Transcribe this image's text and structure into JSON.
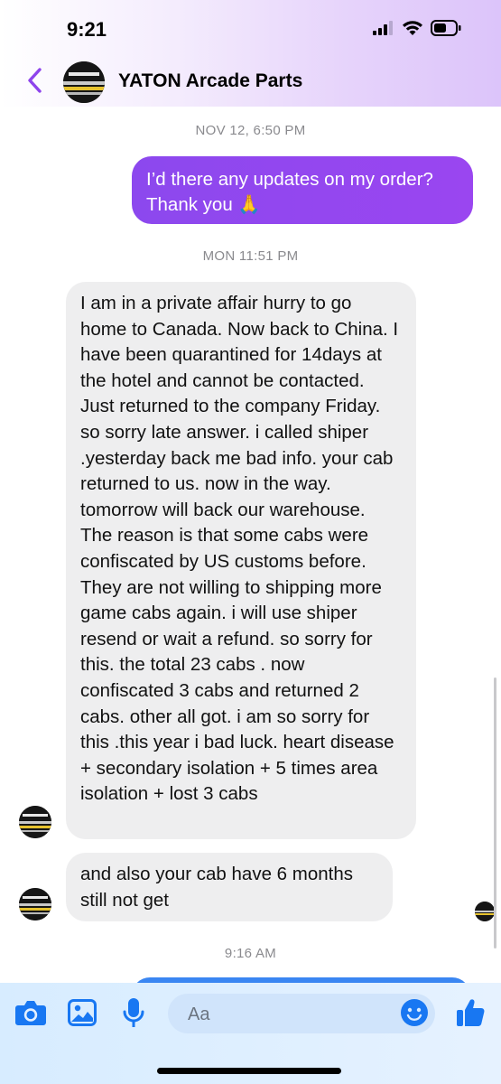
{
  "status_bar": {
    "time": "9:21"
  },
  "header": {
    "contact_name": "YATON Arcade Parts",
    "avatar_text": "YATON ARCADE PARTS"
  },
  "conversation": {
    "timestamps": [
      "NOV 12, 6:50 PM",
      "MON 11:51 PM",
      "9:16 AM"
    ],
    "outgoing": [
      {
        "text": "I’d there any updates on my order? Thank you 🙏"
      }
    ],
    "incoming": [
      {
        "text": "I am in a private affair hurry to go home to Canada. Now back to China. I have been quarantined for 14days at the hotel and cannot be contacted. Just returned to the company Friday. so sorry late answer. i called shiper .yesterday back me bad info. your cab returned to us. now in the way. tomorrow will back our warehouse.  The reason is that some cabs were confiscated by US customs before. They are not willing to shipping  more game cabs again. i will use shiper resend or wait a refund. so sorry for this. the total 23 cabs . now confiscated 3 cabs and returned 2 cabs. other all got.  i am so sorry for this .this year i bad luck. heart disease + secondary isolation + 5 times area isolation + lost 3 cabs"
      },
      {
        "text": "and also your cab have 6 months still not get"
      }
    ]
  },
  "composer": {
    "placeholder": "Aa"
  },
  "colors": {
    "outgoing_bubble": "#9146F0",
    "incoming_bubble": "#EEEEEF",
    "accent": "#1877F2",
    "back_chevron": "#8E44EC"
  },
  "icons": [
    "back-chevron-icon",
    "camera-icon",
    "gallery-icon",
    "microphone-icon",
    "emoji-icon",
    "thumbs-up-icon"
  ]
}
